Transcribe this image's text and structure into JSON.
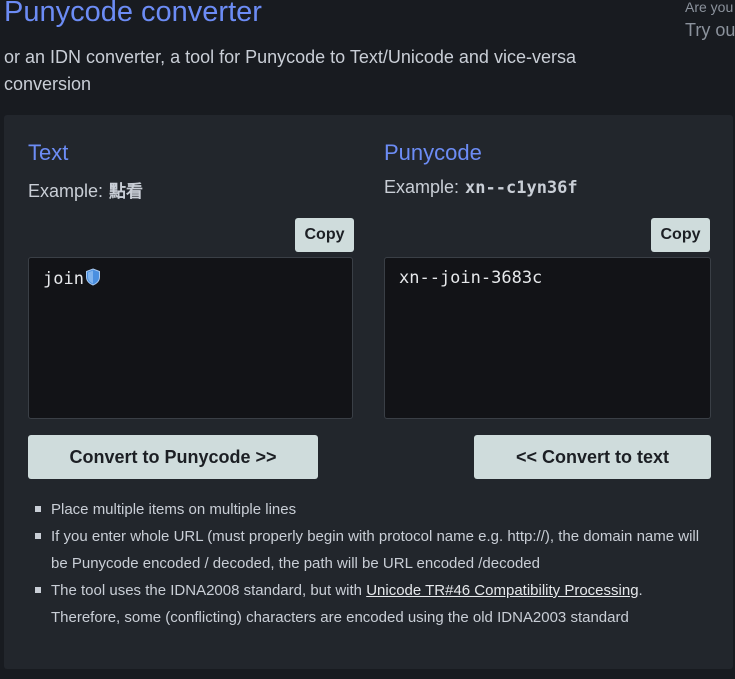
{
  "header": {
    "title": "Punycode converter",
    "subtitle": "or an IDN converter, a tool for Punycode to Text/Unicode and vice-versa conversion",
    "side_small": "Are you",
    "side_big": "Try ou"
  },
  "text_col": {
    "title": "Text",
    "example_label": "Example:",
    "example_value": "點看",
    "copy_label": "Copy",
    "value": "join",
    "value_icon": "shield-emoji"
  },
  "puny_col": {
    "title": "Punycode",
    "example_label": "Example:",
    "example_value": "xn--c1yn36f",
    "copy_label": "Copy",
    "value": "xn--join-3683c"
  },
  "buttons": {
    "to_punycode": "Convert to Punycode >>",
    "to_text": "<< Convert to text"
  },
  "notes": {
    "item1": "Place multiple items on multiple lines",
    "item2": "If you enter whole URL (must properly begin with protocol name e.g. http://), the domain name will be Punycode encoded / decoded, the path will be URL encoded /decoded",
    "item3_before": "The tool uses the IDNA2008 standard, but with ",
    "item3_link": "Unicode TR#46 Compatibility Processing",
    "item3_after": ". Therefore, some (conflicting) characters are encoded using the old IDNA2003 standard"
  },
  "colors": {
    "accent": "#6c8cf5",
    "button_bg": "#cfdcdc",
    "panel_bg": "#22262c",
    "page_bg": "#181b20"
  }
}
